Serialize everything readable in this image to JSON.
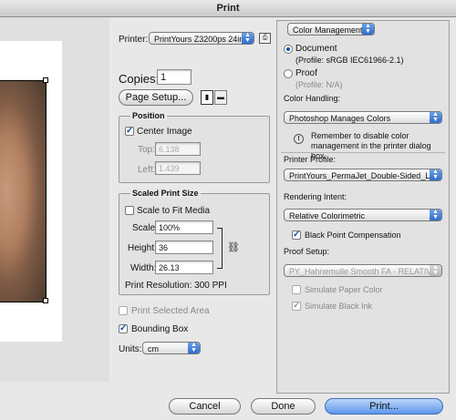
{
  "window": {
    "title": "Print"
  },
  "printer": {
    "label": "Printer:",
    "value": "PrintYours Z3200ps 24in..."
  },
  "copies": {
    "label": "Copies:",
    "value": "1"
  },
  "page_setup": {
    "label": "Page Setup..."
  },
  "position": {
    "title": "Position",
    "center_image": "Center Image",
    "top_label": "Top:",
    "top_value": "6.138",
    "left_label": "Left:",
    "left_value": "1.439"
  },
  "scaled_print_size": {
    "title": "Scaled Print Size",
    "scale_to_fit": "Scale to Fit Media",
    "scale_label": "Scale:",
    "scale_value": "100%",
    "height_label": "Height:",
    "height_value": "36",
    "width_label": "Width:",
    "width_value": "26.13",
    "resolution": "Print Resolution: 300 PPI"
  },
  "print_selected_area": "Print Selected Area",
  "bounding_box": "Bounding Box",
  "units": {
    "label": "Units:",
    "value": "cm"
  },
  "right_panel": {
    "mode": "Color Management",
    "document_label": "Document",
    "document_profile": "(Profile: sRGB IEC61966-2.1)",
    "proof_label": "Proof",
    "proof_profile": "(Profile: N/A)",
    "color_handling_label": "Color Handling:",
    "color_handling_value": "Photoshop Manages Colors",
    "notice": "Remember to disable color management in the printer dialog box.",
    "printer_profile_label": "Printer Profile:",
    "printer_profile_value": "PrintYours_PermaJet_Double-Sided_Lustr...",
    "rendering_intent_label": "Rendering Intent:",
    "rendering_intent_value": "Relative Colorimetric",
    "black_point": "Black Point Compensation",
    "proof_setup_label": "Proof Setup:",
    "proof_setup_value": "PY_Hahnemulle Smooth FA - RELATIVE Col",
    "simulate_paper": "Simulate Paper Color",
    "simulate_ink": "Simulate Black Ink"
  },
  "buttons": {
    "cancel": "Cancel",
    "done": "Done",
    "print": "Print..."
  }
}
